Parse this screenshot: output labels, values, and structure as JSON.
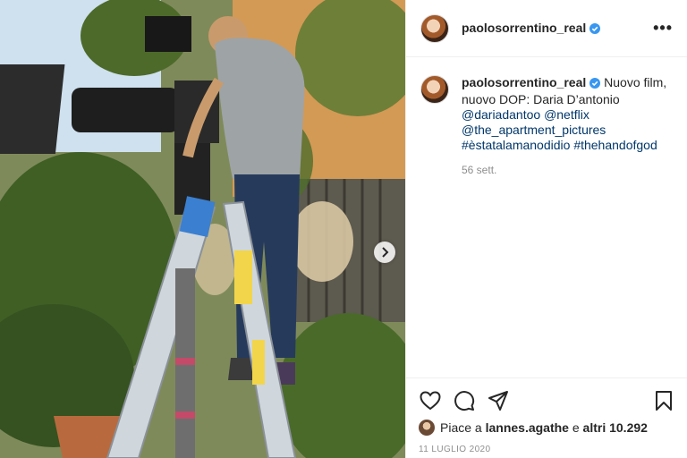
{
  "post": {
    "username": "paolosorrentino_real",
    "caption_text_1": "Nuovo film, nuovo DOP: Daria D’antonio",
    "mentions": [
      "@dariadantoo",
      "@netflix",
      "@the_apartment_pictures"
    ],
    "hashtags": [
      "#èstatalamanodidio",
      "#thehandofgod"
    ],
    "time_ago": "56 sett.",
    "likes_prefix": "Piace a",
    "liked_by": "lannes.agathe",
    "likes_mid": "e",
    "likes_count": "altri 10.292",
    "date": "11 LUGLIO 2020"
  },
  "icons": {
    "more": "more-options-icon",
    "like": "heart-icon",
    "comment": "comment-icon",
    "share": "paper-plane-icon",
    "save": "bookmark-icon",
    "next": "chevron-right-icon",
    "verified": "verified-badge-icon"
  },
  "colors": {
    "link": "#00376b",
    "verified": "#3897f0",
    "muted": "#8e8e8e"
  }
}
